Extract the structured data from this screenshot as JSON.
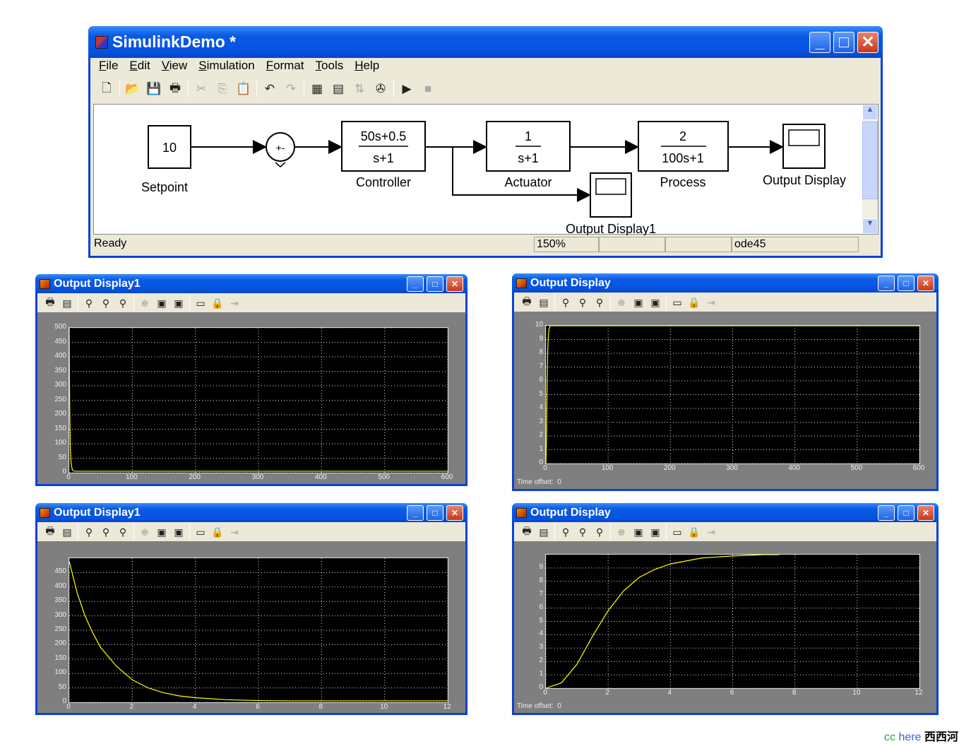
{
  "simulink": {
    "title": "SimulinkDemo *",
    "menu": [
      "File",
      "Edit",
      "View",
      "Simulation",
      "Format",
      "Tools",
      "Help"
    ],
    "toolbar_icons": [
      "new-icon",
      "open-icon",
      "save-icon",
      "print-icon",
      "cut-icon",
      "copy-icon",
      "paste-icon",
      "undo-icon",
      "redo-icon",
      "library-browser-icon",
      "model-explorer-icon",
      "toggle-model-icon",
      "debug-icon",
      "start-simulation-icon",
      "stop-simulation-icon"
    ],
    "blocks": {
      "setpoint_value": "10",
      "setpoint_label": "Setpoint",
      "sum_signs": "+-",
      "controller_num": "50s+0.5",
      "controller_den": "s+1",
      "controller_label": "Controller",
      "actuator_num": "1",
      "actuator_den": "s+1",
      "actuator_label": "Actuator",
      "process_num": "2",
      "process_den": "100s+1",
      "process_label": "Process",
      "scope1_label": "Output Display",
      "scope2_label": "Output Display1"
    },
    "status": {
      "state": "Ready",
      "zoom": "150%",
      "solver": "ode45"
    }
  },
  "scopes": [
    {
      "title": "Output Display1",
      "time_offset": null
    },
    {
      "title": "Output Display",
      "time_offset_label": "Time offset:",
      "time_offset": "0"
    },
    {
      "title": "Output Display1",
      "time_offset": null
    },
    {
      "title": "Output Display",
      "time_offset_label": "Time offset:",
      "time_offset": "0"
    }
  ],
  "scope_toolbar_icons": [
    "print-icon",
    "parameters-icon",
    "zoom-icon",
    "zoom-x-icon",
    "zoom-y-icon",
    "autoscale-icon",
    "save-axes-icon",
    "restore-axes-icon",
    "floating-scope-icon",
    "lock-axes-icon",
    "signal-selector-icon"
  ],
  "chart_data": [
    {
      "type": "line",
      "xlim": [
        0,
        600
      ],
      "ylim": [
        0,
        500
      ],
      "xticks": [
        0,
        100,
        200,
        300,
        400,
        500,
        600
      ],
      "yticks": [
        0,
        50,
        100,
        150,
        200,
        250,
        300,
        350,
        400,
        450,
        500
      ],
      "grid": true,
      "line_color": "#ffff00",
      "x": [
        0,
        0.5,
        1,
        2,
        3,
        5,
        8,
        12,
        50,
        600
      ],
      "y": [
        500,
        300,
        190,
        78,
        33,
        9,
        5,
        5,
        5,
        5
      ]
    },
    {
      "type": "line",
      "xlim": [
        0,
        600
      ],
      "ylim": [
        0,
        10
      ],
      "xticks": [
        0,
        100,
        200,
        300,
        400,
        500,
        600
      ],
      "yticks": [
        0,
        1,
        2,
        3,
        4,
        5,
        6,
        7,
        8,
        9,
        10
      ],
      "grid": true,
      "line_color": "#ffff00",
      "x": [
        0,
        1,
        2,
        3,
        4,
        5,
        7,
        600
      ],
      "y": [
        0,
        1.8,
        5.8,
        8.3,
        9.3,
        9.75,
        10,
        10
      ]
    },
    {
      "type": "line",
      "xlim": [
        0,
        12
      ],
      "ylim": [
        0,
        500
      ],
      "xticks": [
        0,
        2,
        4,
        6,
        8,
        10,
        12
      ],
      "yticks": [
        0,
        50,
        100,
        150,
        200,
        250,
        300,
        350,
        400,
        450
      ],
      "grid": true,
      "line_color": "#ffff00",
      "x": [
        0,
        0.25,
        0.5,
        0.75,
        1,
        1.5,
        2,
        2.5,
        3,
        3.5,
        4,
        5,
        6,
        7,
        8,
        10,
        12
      ],
      "y": [
        490,
        380,
        300,
        240,
        190,
        125,
        78,
        50,
        33,
        22,
        16,
        9,
        6,
        5,
        5,
        5,
        5
      ]
    },
    {
      "type": "line",
      "xlim": [
        0,
        12
      ],
      "ylim": [
        0,
        10
      ],
      "xticks": [
        0,
        2,
        4,
        6,
        8,
        10,
        12
      ],
      "yticks": [
        0,
        1,
        2,
        3,
        4,
        5,
        6,
        7,
        8,
        9
      ],
      "grid": true,
      "line_color": "#ffff00",
      "x": [
        0,
        0.5,
        1,
        1.5,
        2,
        2.5,
        3,
        3.5,
        4,
        5,
        6,
        7,
        7.5
      ],
      "y": [
        0,
        0.4,
        1.8,
        3.9,
        5.8,
        7.3,
        8.3,
        8.9,
        9.3,
        9.75,
        9.9,
        10,
        10
      ]
    }
  ],
  "watermark": {
    "a": "cc",
    "b": "here",
    "c": "西西河"
  }
}
